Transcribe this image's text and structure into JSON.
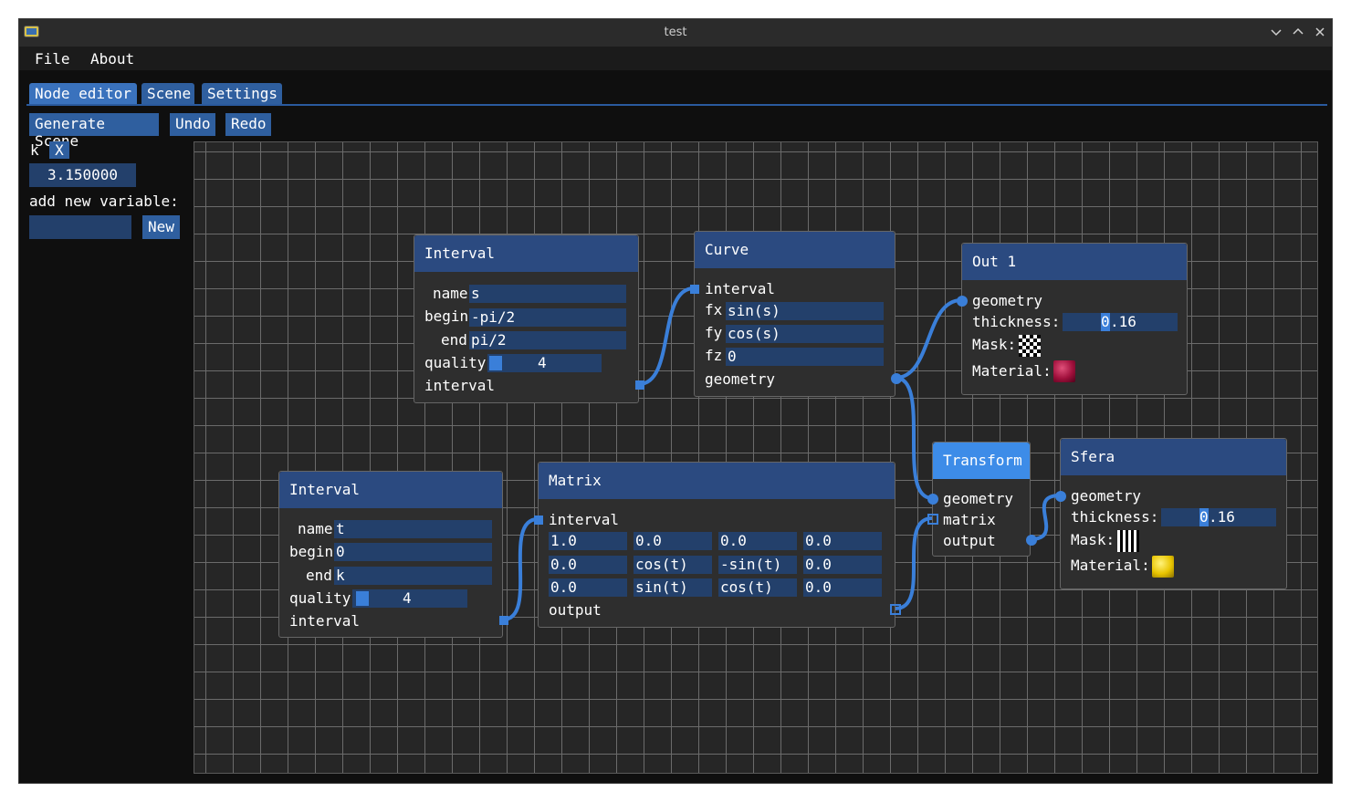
{
  "window": {
    "title": "test"
  },
  "menu": {
    "file": "File",
    "about": "About"
  },
  "tabs": [
    {
      "label": "Node editor",
      "active": true
    },
    {
      "label": "Scene",
      "active": false
    },
    {
      "label": "Settings",
      "active": false
    }
  ],
  "toolbar": {
    "generate": "Generate Scene",
    "undo": "Undo",
    "redo": "Redo"
  },
  "variables": {
    "name": "k",
    "delete_label": "X",
    "value": "3.150000",
    "add_label": "add new variable:",
    "new_input_value": "",
    "new_button": "New"
  },
  "nodes": {
    "interval_s": {
      "title": "Interval",
      "name_label": "name",
      "name_value": "s",
      "begin_label": "begin",
      "begin_value": "-pi/2",
      "end_label": "end",
      "end_value": "pi/2",
      "quality_label": "quality",
      "quality_value": "4",
      "output_label": "interval"
    },
    "curve": {
      "title": "Curve",
      "interval_label": "interval",
      "fx_label": "fx",
      "fx_value": "sin(s)",
      "fy_label": "fy",
      "fy_value": "cos(s)",
      "fz_label": "fz",
      "fz_value": "0",
      "output_label": "geometry"
    },
    "out1": {
      "title": "Out 1",
      "geometry_label": "geometry",
      "thickness_label": "thickness:",
      "thickness_first": "0",
      "thickness_rest": ".16",
      "mask_label": "Mask:",
      "material_label": "Material:"
    },
    "interval_t": {
      "title": "Interval",
      "name_label": "name",
      "name_value": "t",
      "begin_label": "begin",
      "begin_value": "0",
      "end_label": "end",
      "end_value": "k",
      "quality_label": "quality",
      "quality_value": "4",
      "output_label": "interval"
    },
    "matrix": {
      "title": "Matrix",
      "interval_label": "interval",
      "rows": [
        [
          "1.0",
          "0.0",
          "0.0",
          "0.0"
        ],
        [
          "0.0",
          "cos(t)",
          "-sin(t)",
          "0.0"
        ],
        [
          "0.0",
          "sin(t)",
          "cos(t)",
          "0.0"
        ]
      ],
      "output_label": "output"
    },
    "transform": {
      "title": "Transform",
      "geometry_label": "geometry",
      "matrix_label": "matrix",
      "output_label": "output"
    },
    "sfera": {
      "title": "Sfera",
      "geometry_label": "geometry",
      "thickness_label": "thickness:",
      "thickness_first": "0",
      "thickness_rest": ".16",
      "mask_label": "Mask:",
      "material_label": "Material:"
    }
  },
  "colors": {
    "accent": "#3a7fd9",
    "node_header": "#2b4a80",
    "node_header_selected": "#3d8ce8",
    "input_bg": "#23406b"
  }
}
